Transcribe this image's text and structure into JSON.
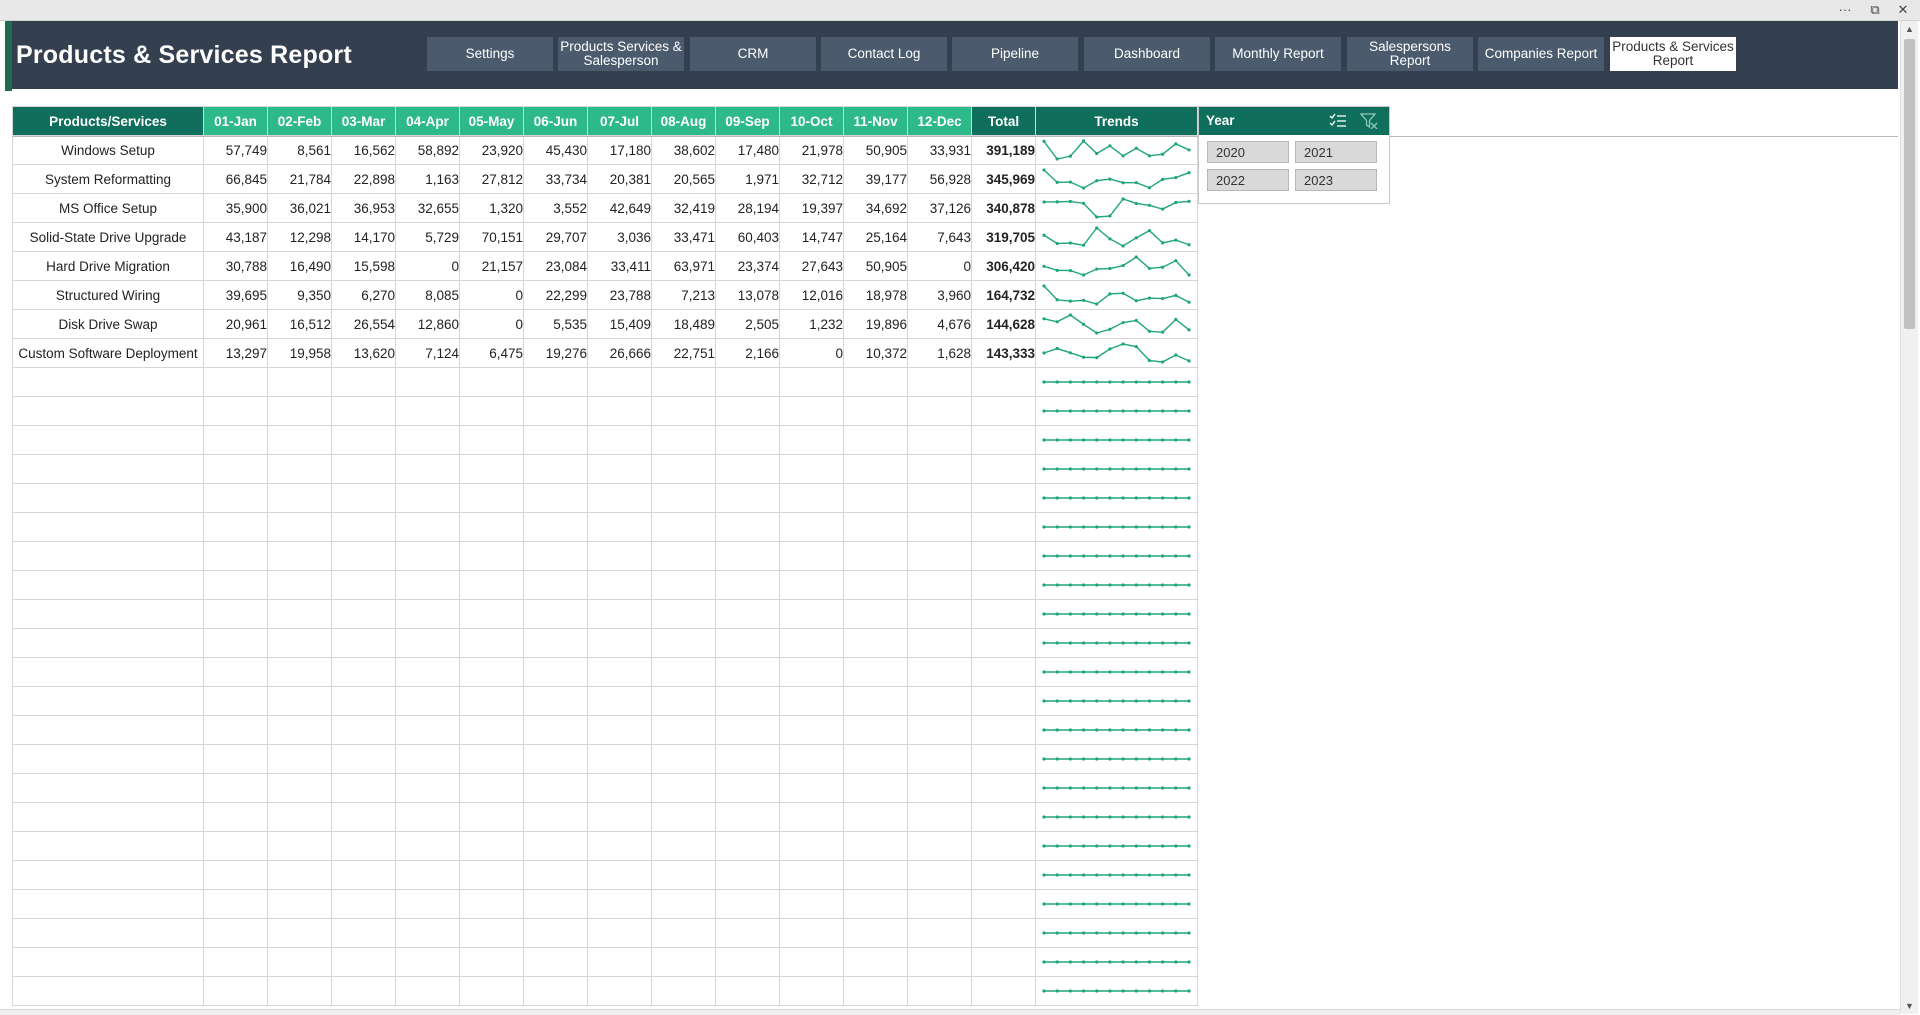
{
  "window": {
    "more": "···",
    "restore": "⧉",
    "close": "✕"
  },
  "header": {
    "title": "Products & Services Report",
    "nav": [
      {
        "label": "Settings",
        "active": false
      },
      {
        "label": "Products Services &\nSalesperson",
        "active": false
      },
      {
        "label": "CRM",
        "active": false
      },
      {
        "label": "Contact Log",
        "active": false
      },
      {
        "label": "Pipeline",
        "active": false
      },
      {
        "label": "Dashboard",
        "active": false
      },
      {
        "label": "Monthly Report",
        "active": false
      },
      {
        "label": "Salespersons Report",
        "active": false
      },
      {
        "label": "Companies Report",
        "active": false
      },
      {
        "label": "Products & Services\nReport",
        "active": true
      }
    ]
  },
  "table": {
    "columns": [
      "Products/Services",
      "01-Jan",
      "02-Feb",
      "03-Mar",
      "04-Apr",
      "05-May",
      "06-Jun",
      "07-Jul",
      "08-Aug",
      "09-Sep",
      "10-Oct",
      "11-Nov",
      "12-Dec",
      "Total",
      "Trends"
    ],
    "rows": [
      {
        "name": "Windows Setup",
        "values": [
          "57,749",
          "8,561",
          "16,562",
          "58,892",
          "23,920",
          "45,430",
          "17,180",
          "38,602",
          "17,480",
          "21,978",
          "50,905",
          "33,931"
        ],
        "total": "391,189"
      },
      {
        "name": "System Reformatting",
        "values": [
          "66,845",
          "21,784",
          "22,898",
          "1,163",
          "27,812",
          "33,734",
          "20,381",
          "20,565",
          "1,971",
          "32,712",
          "39,177",
          "56,928"
        ],
        "total": "345,969"
      },
      {
        "name": "MS Office Setup",
        "values": [
          "35,900",
          "36,021",
          "36,953",
          "32,655",
          "1,320",
          "3,552",
          "42,649",
          "32,419",
          "28,194",
          "19,397",
          "34,692",
          "37,126"
        ],
        "total": "340,878"
      },
      {
        "name": "Solid-State Drive Upgrade",
        "values": [
          "43,187",
          "12,298",
          "14,170",
          "5,729",
          "70,151",
          "29,707",
          "3,036",
          "33,471",
          "60,403",
          "14,747",
          "25,164",
          "7,643"
        ],
        "total": "319,705"
      },
      {
        "name": "Hard Drive Migration",
        "values": [
          "30,788",
          "16,490",
          "15,598",
          "0",
          "21,157",
          "23,084",
          "33,411",
          "63,971",
          "23,374",
          "27,643",
          "50,905",
          "0"
        ],
        "total": "306,420"
      },
      {
        "name": "Structured Wiring",
        "values": [
          "39,695",
          "9,350",
          "6,270",
          "8,085",
          "0",
          "22,299",
          "23,788",
          "7,213",
          "13,078",
          "12,016",
          "18,978",
          "3,960"
        ],
        "total": "164,732"
      },
      {
        "name": "Disk Drive Swap",
        "values": [
          "20,961",
          "16,512",
          "26,554",
          "12,860",
          "0",
          "5,535",
          "15,409",
          "18,489",
          "2,505",
          "1,232",
          "19,896",
          "4,676"
        ],
        "total": "144,628"
      },
      {
        "name": "Custom Software Deployment",
        "values": [
          "13,297",
          "19,958",
          "13,620",
          "7,124",
          "6,475",
          "19,276",
          "26,666",
          "22,751",
          "2,166",
          "0",
          "10,372",
          "1,628"
        ],
        "total": "143,333"
      }
    ],
    "empty_rows": 22
  },
  "slicer": {
    "title": "Year",
    "items": [
      "2020",
      "2021",
      "2022",
      "2023"
    ]
  },
  "colors": {
    "header_bg": "#34404f",
    "nav_bg": "#4b5b6d",
    "dark_green": "#0f6f5c",
    "light_green": "#2db98a",
    "sparkline": "#1fa57e"
  }
}
